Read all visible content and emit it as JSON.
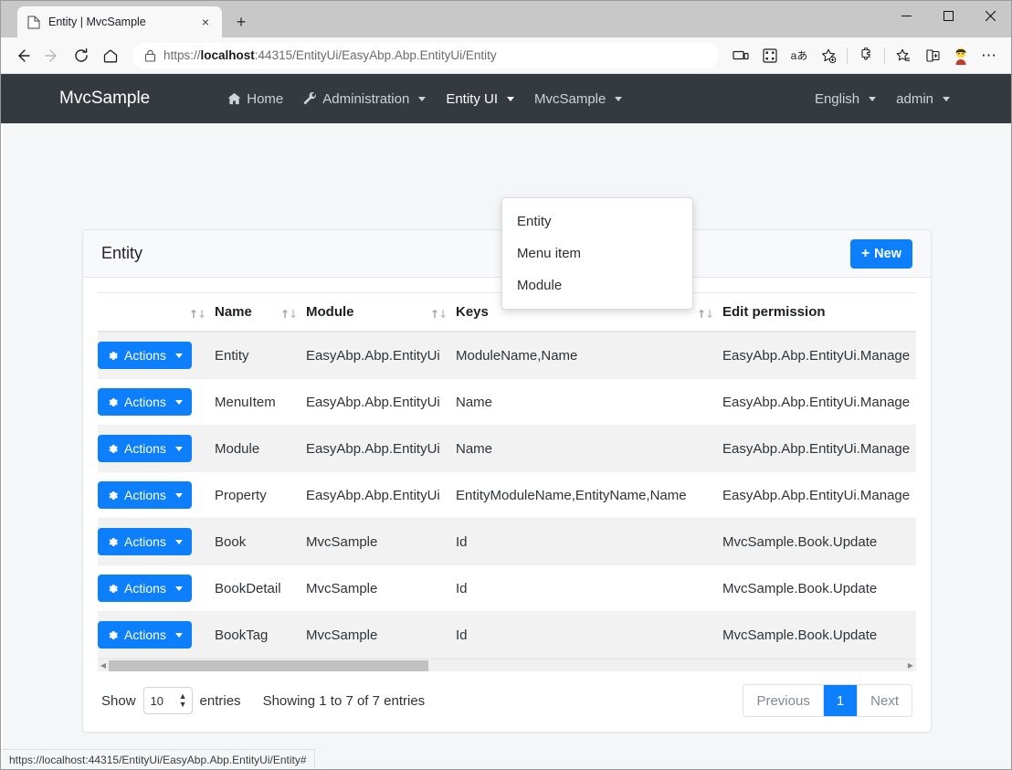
{
  "browser": {
    "tab": {
      "title": "Entity | MvcSample",
      "favicon": "page-icon",
      "close": "×"
    },
    "new_tab": "+",
    "window_controls": {
      "minimize": "—",
      "maximize": "□",
      "close": "✕"
    },
    "nav": {
      "back": "←",
      "forward": "→",
      "reload": "⟳",
      "home": "⌂"
    },
    "url": {
      "scheme": "https://",
      "host": "localhost",
      "rest": ":44315/EntityUi/EasyAbp.Abp.EntityUi/Entity",
      "full": "https://localhost:44315/EntityUi/EasyAbp.Abp.EntityUi/Entity"
    },
    "toolbar_icons": [
      "device-cast-icon",
      "qr-code-icon",
      "read-aloud-icon",
      "add-favorite-icon",
      "extensions-icon",
      "favorites-icon",
      "collections-icon",
      "profile-avatar-icon",
      "settings-more-icon"
    ],
    "status_bar_url": "https://localhost:44315/EntityUi/EasyAbp.Abp.EntityUi/Entity#"
  },
  "navbar": {
    "brand": "MvcSample",
    "left_items": [
      {
        "label": "Home",
        "icon": "home-icon",
        "caret": false,
        "active": false
      },
      {
        "label": "Administration",
        "icon": "wrench-icon",
        "caret": true,
        "active": false
      },
      {
        "label": "Entity UI",
        "icon": "",
        "caret": true,
        "active": true
      },
      {
        "label": "MvcSample",
        "icon": "",
        "caret": true,
        "active": false
      }
    ],
    "right_items": [
      {
        "label": "English",
        "caret": true
      },
      {
        "label": "admin",
        "caret": true
      }
    ]
  },
  "dropdown": {
    "items": [
      "Entity",
      "Menu item",
      "Module"
    ]
  },
  "card": {
    "title": "Entity",
    "new_button": {
      "label": "New",
      "icon": "plus-icon"
    },
    "accent_color": "#0d7ffb"
  },
  "table": {
    "columns": [
      {
        "key": "actions",
        "label": "",
        "sortable": true
      },
      {
        "key": "name",
        "label": "Name",
        "sortable": true
      },
      {
        "key": "module",
        "label": "Module",
        "sortable": true
      },
      {
        "key": "keys",
        "label": "Keys",
        "sortable": true
      },
      {
        "key": "edit_permission",
        "label": "Edit permission",
        "sortable": true
      }
    ],
    "action_label": "Actions",
    "rows": [
      {
        "name": "Entity",
        "module": "EasyAbp.Abp.EntityUi",
        "keys": "ModuleName,Name",
        "edit_permission": "EasyAbp.Abp.EntityUi.Manage"
      },
      {
        "name": "MenuItem",
        "module": "EasyAbp.Abp.EntityUi",
        "keys": "Name",
        "edit_permission": "EasyAbp.Abp.EntityUi.Manage"
      },
      {
        "name": "Module",
        "module": "EasyAbp.Abp.EntityUi",
        "keys": "Name",
        "edit_permission": "EasyAbp.Abp.EntityUi.Manage"
      },
      {
        "name": "Property",
        "module": "EasyAbp.Abp.EntityUi",
        "keys": "EntityModuleName,EntityName,Name",
        "edit_permission": "EasyAbp.Abp.EntityUi.Manage"
      },
      {
        "name": "Book",
        "module": "MvcSample",
        "keys": "Id",
        "edit_permission": "MvcSample.Book.Update"
      },
      {
        "name": "BookDetail",
        "module": "MvcSample",
        "keys": "Id",
        "edit_permission": "MvcSample.Book.Update"
      },
      {
        "name": "BookTag",
        "module": "MvcSample",
        "keys": "Id",
        "edit_permission": "MvcSample.Book.Update"
      }
    ]
  },
  "footer": {
    "show_label": "Show",
    "entries_value": "10",
    "entries_label": "entries",
    "showing_info": "Showing 1 to 7 of 7 entries",
    "pagination": {
      "previous": "Previous",
      "pages": [
        "1"
      ],
      "next": "Next",
      "current": "1"
    }
  }
}
